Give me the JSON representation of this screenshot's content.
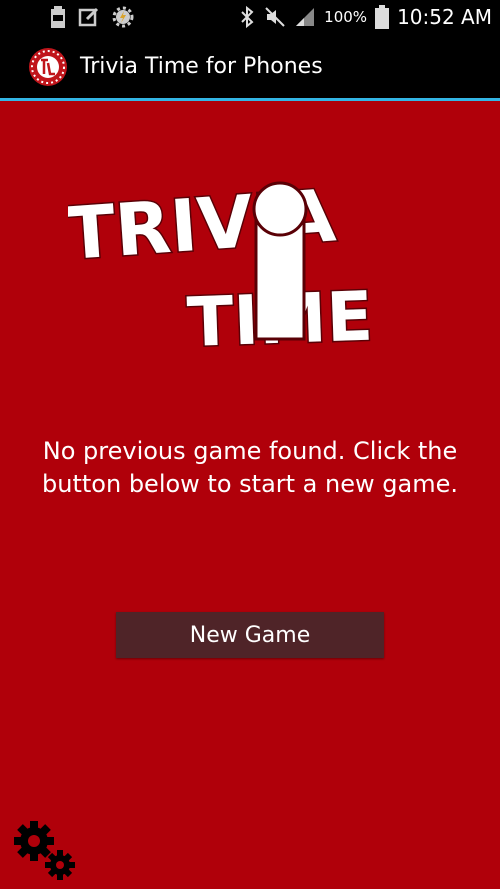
{
  "status_bar": {
    "battery_percent": "100%",
    "time": "10:52 AM",
    "left_icons": [
      "battery-100-icon",
      "edit-note-icon",
      "settings-icon"
    ],
    "right_icons": [
      "bluetooth-icon",
      "mute-icon",
      "signal-icon",
      "battery-icon"
    ]
  },
  "action_bar": {
    "title": "Trivia Time for Phones",
    "logo_icon": "trivia-time-app-icon"
  },
  "main": {
    "logo_text_line1": "TRIVIA",
    "logo_text_line2": "TIME",
    "message": "No previous game found.  Click the button below to start a new game.",
    "new_game_label": "New Game",
    "settings_icon": "gears-icon"
  },
  "colors": {
    "background": "#b0000a",
    "accent_divider": "#33b5e5",
    "button": "#4f2428"
  }
}
